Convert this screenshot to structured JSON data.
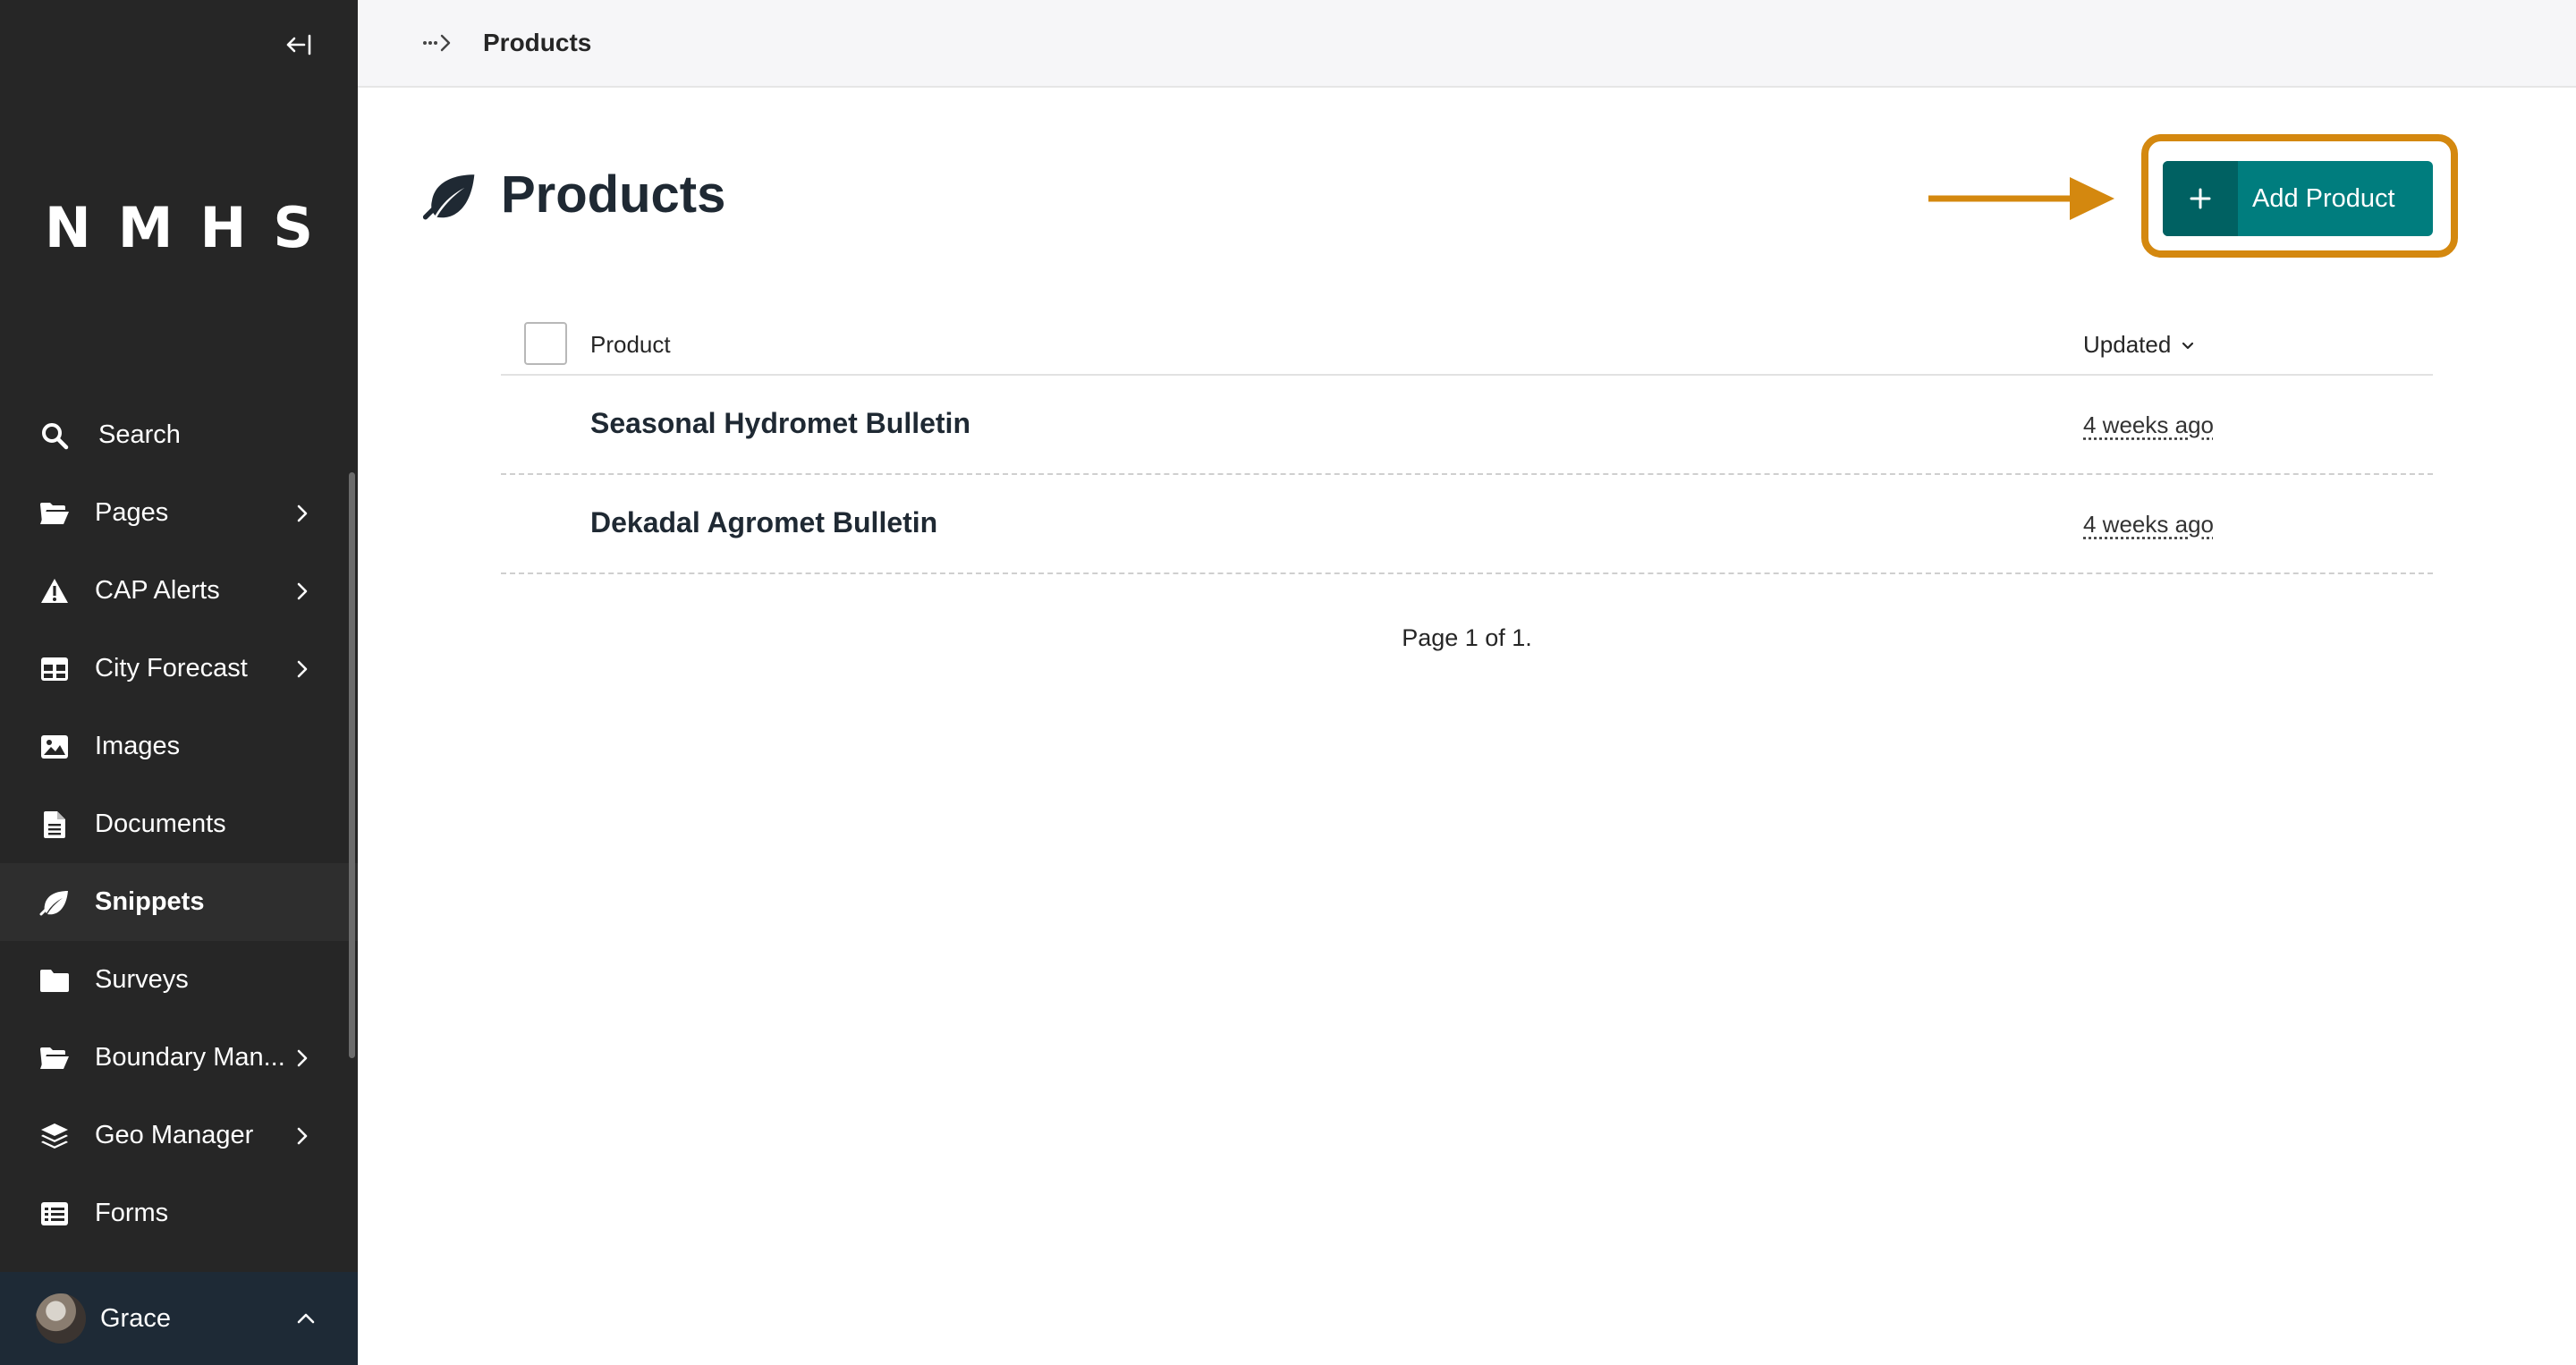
{
  "sidebar": {
    "logo": "NMHS",
    "items": [
      {
        "label": "Search",
        "icon": "search-icon",
        "has_submenu": false
      },
      {
        "label": "Pages",
        "icon": "folder-open-icon",
        "has_submenu": true
      },
      {
        "label": "CAP Alerts",
        "icon": "warning-icon",
        "has_submenu": true
      },
      {
        "label": "City Forecast",
        "icon": "table-icon",
        "has_submenu": true
      },
      {
        "label": "Images",
        "icon": "image-icon",
        "has_submenu": false
      },
      {
        "label": "Documents",
        "icon": "document-icon",
        "has_submenu": false
      },
      {
        "label": "Snippets",
        "icon": "leaf-icon",
        "has_submenu": false,
        "active": true
      },
      {
        "label": "Surveys",
        "icon": "folder-icon",
        "has_submenu": false
      },
      {
        "label": "Boundary Man...",
        "icon": "folder-open-icon",
        "has_submenu": true
      },
      {
        "label": "Geo Manager",
        "icon": "layers-icon",
        "has_submenu": true
      },
      {
        "label": "Forms",
        "icon": "list-icon",
        "has_submenu": false
      }
    ],
    "user": {
      "name": "Grace"
    }
  },
  "header": {
    "breadcrumb_current": "Products"
  },
  "main": {
    "title": "Products",
    "add_button_label": "Add Product",
    "table": {
      "columns": [
        "Product",
        "Updated"
      ],
      "rows": [
        {
          "product": "Seasonal Hydromet Bulletin",
          "updated": "4 weeks ago"
        },
        {
          "product": "Dekadal Agromet Bulletin",
          "updated": "4 weeks ago"
        }
      ]
    },
    "pagination": "Page 1 of 1."
  },
  "colors": {
    "sidebar_bg": "#262626",
    "accent_teal": "#007d7e",
    "annotation_orange": "#d4880f"
  }
}
